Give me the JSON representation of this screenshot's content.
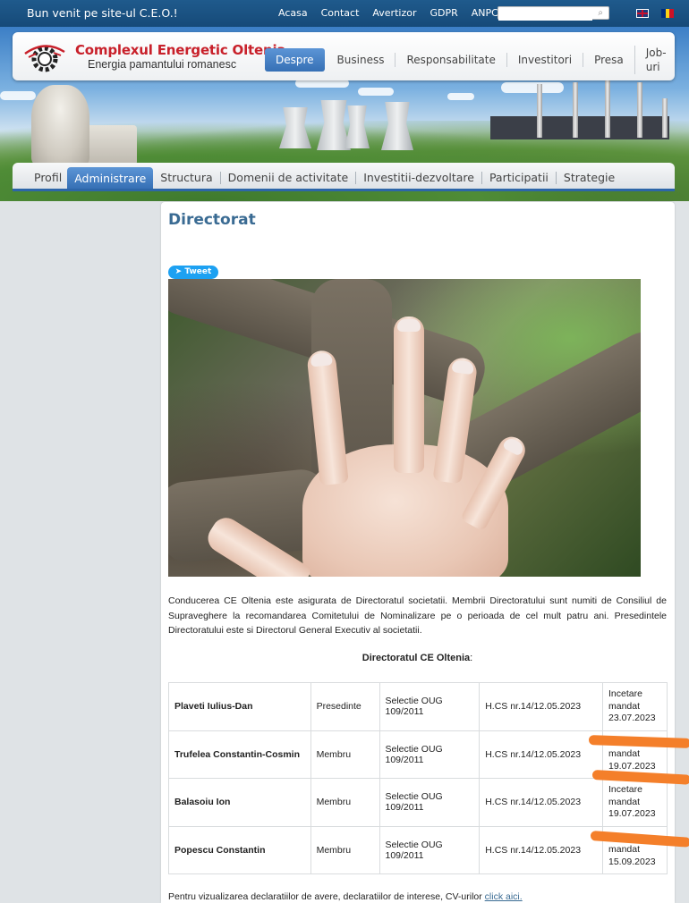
{
  "topbar": {
    "welcome": "Bun venit pe site-ul C.E.O.!",
    "links": [
      "Acasa",
      "Contact",
      "Avertizor",
      "GDPR",
      "ANPC"
    ],
    "search_placeholder": ""
  },
  "brand": {
    "name": "Complexul Energetic Oltenia",
    "tagline": "Energia pamantului romanesc",
    "logo_icon": "gear-logo-icon",
    "color": "#c8202a"
  },
  "main_nav": {
    "items": [
      "Despre",
      "Business",
      "Responsabilitate",
      "Investitori",
      "Presa",
      "Job-uri"
    ],
    "active": "Despre"
  },
  "sub_nav": {
    "items": [
      "Profil",
      "Administrare",
      "Structura",
      "Domenii de activitate",
      "Investitii-dezvoltare",
      "Participatii",
      "Strategie"
    ],
    "active": "Administrare"
  },
  "page": {
    "title": "Directorat",
    "tweet_label": "Tweet",
    "intro": "Conducerea CE Oltenia este asigurata de Directoratul societatii. Membrii Directoratului sunt numiti de Consiliul de Supraveghere la recomandarea Comitetului de Nominalizare pe o perioada de cel mult patru ani. Presedintele Directoratului este si Directorul General Executiv al societatii.",
    "table_title": "Directoratul CE Oltenia",
    "table_title_suffix": ":",
    "rows": [
      {
        "name": "Plaveti Iulius-Dan",
        "role": "Presedinte",
        "selection": "Selectie OUG 109/2011",
        "hcs": "H.CS nr.14/12.05.2023",
        "end_line1": "Incetare",
        "end_line2": "mandat",
        "end_line3": "23.07.2023"
      },
      {
        "name": "Trufelea Constantin-Cosmin",
        "role": "Membru",
        "selection": "Selectie OUG 109/2011",
        "hcs": "H.CS nr.14/12.05.2023",
        "end_line1": "",
        "end_line2": "mandat",
        "end_line3": "19.07.2023"
      },
      {
        "name": "Balasoiu Ion",
        "role": "Membru",
        "selection": "Selectie OUG 109/2011",
        "hcs": "H.CS nr.14/12.05.2023",
        "end_line1": "Incetare",
        "end_line2": "mandat",
        "end_line3": "19.07.2023"
      },
      {
        "name": "Popescu Constantin",
        "role": "Membru",
        "selection": "Selectie OUG 109/2011",
        "hcs": "H.CS nr.14/12.05.2023",
        "end_line1": "",
        "end_line2": "mandat",
        "end_line3": "15.09.2023"
      }
    ],
    "footer_text": "Pentru vizualizarea declaratiilor de avere, declaratiilor de interese, CV-urilor ",
    "footer_link": "click aici."
  },
  "colors": {
    "accent": "#3670b5",
    "title": "#3a6b93",
    "tweet": "#1da1f2",
    "annotation": "#f47f2a"
  }
}
